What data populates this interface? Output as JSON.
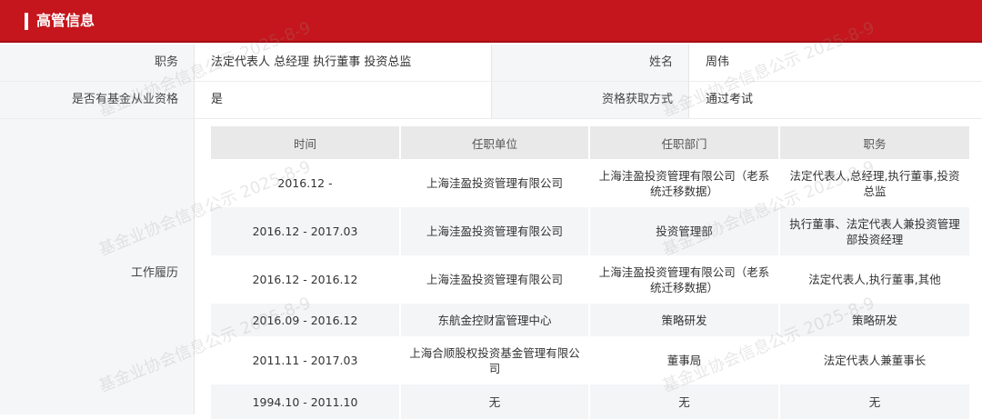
{
  "section": {
    "title": "高管信息"
  },
  "info": {
    "position_label": "职务",
    "position_value": "法定代表人 总经理 执行董事 投资总监",
    "name_label": "姓名",
    "name_value": "周伟",
    "qualified_label": "是否有基金从业资格",
    "qualified_value": "是",
    "method_label": "资格获取方式",
    "method_value": "通过考试"
  },
  "career": {
    "label": "工作履历",
    "headers": [
      "时间",
      "任职单位",
      "任职部门",
      "职务"
    ],
    "rows": [
      [
        "2016.12 -",
        "上海洼盈投资管理有限公司",
        "上海洼盈投资管理有限公司（老系统迁移数据）",
        "法定代表人,总经理,执行董事,投资总监"
      ],
      [
        "2016.12 - 2017.03",
        "上海洼盈投资管理有限公司",
        "投资管理部",
        "执行董事、法定代表人兼投资管理部投资经理"
      ],
      [
        "2016.12 - 2016.12",
        "上海洼盈投资管理有限公司",
        "上海洼盈投资管理有限公司（老系统迁移数据）",
        "法定代表人,执行董事,其他"
      ],
      [
        "2016.09 - 2016.12",
        "东航金控财富管理中心",
        "策略研发",
        "策略研发"
      ],
      [
        "2011.11 - 2017.03",
        "上海合顺股权投资基金管理有限公司",
        "董事局",
        "法定代表人兼董事长"
      ],
      [
        "1994.10 - 2011.10",
        "无",
        "无",
        "无"
      ]
    ]
  },
  "watermark": "基金业协会信息公示 2025-8-9"
}
